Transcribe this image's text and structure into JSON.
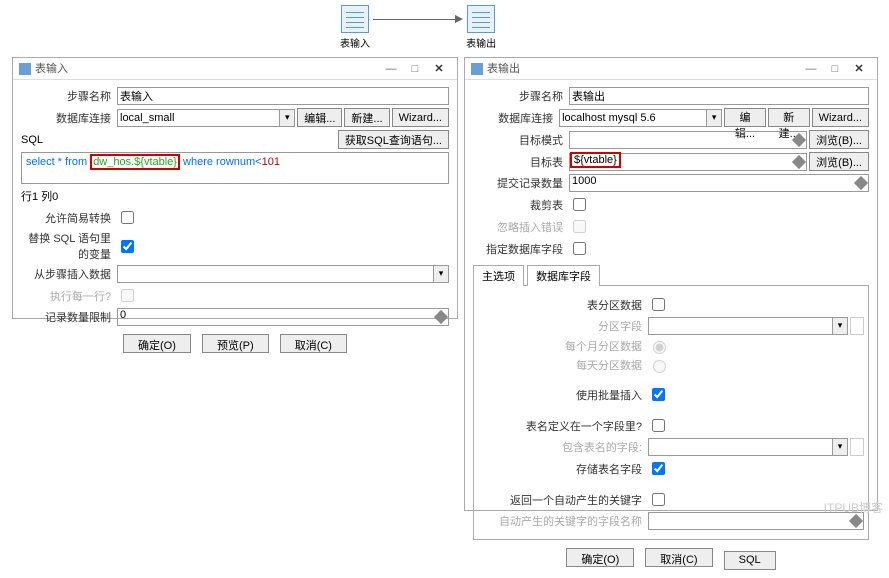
{
  "flow": {
    "node_in": "表输入",
    "node_out": "表输出"
  },
  "dlg_in": {
    "title": "表输入",
    "labels": {
      "step_name": "步骤名称",
      "db_conn": "数据库连接",
      "sql": "SQL",
      "allow_simple": "允许简易转换",
      "replace_vars": "替换 SQL 语句里的变量",
      "from_step": "从步骤插入数据",
      "per_row": "执行每一行?",
      "row_limit": "记录数量限制"
    },
    "values": {
      "step_name": "表输入",
      "db_conn": "local_small",
      "row_limit": "0"
    },
    "sql": {
      "p1": "select * from ",
      "hl": "dw_hos.${vtable}",
      "p2": " where rownum<",
      "p3": "101"
    },
    "buttons": {
      "edit": "编辑...",
      "new": "新建...",
      "wizard": "Wizard...",
      "get_sql": "获取SQL查询语句..."
    },
    "status": "行1 列0",
    "footer": {
      "ok": "确定(O)",
      "preview": "预览(P)",
      "cancel": "取消(C)"
    }
  },
  "dlg_out": {
    "title": "表输出",
    "labels": {
      "step_name": "步骤名称",
      "db_conn": "数据库连接",
      "target_schema": "目标模式",
      "target_table": "目标表",
      "commit_size": "提交记录数量",
      "truncate": "裁剪表",
      "ignore_errors": "忽略插入错误",
      "specify_fields": "指定数据库字段",
      "partition": "表分区数据",
      "partition_field": "分区字段",
      "per_month": "每个月分区数据",
      "per_day": "每天分区数据",
      "batch": "使用批量插入",
      "name_in_field": "表名定义在一个字段里?",
      "contain_name_field": "包含表名的字段:",
      "store_name_field": "存储表名字段",
      "return_key": "返回一个自动产生的关键字",
      "auto_key_field": "自动产生的关键字的字段名称"
    },
    "values": {
      "step_name": "表输出",
      "db_conn": "localhost mysql 5.6",
      "target_table": "${vtable}",
      "commit_size": "1000"
    },
    "tabs": {
      "main": "主选项",
      "fields": "数据库字段"
    },
    "buttons": {
      "edit": "编辑...",
      "new": "新建...",
      "wizard": "Wizard...",
      "browse": "浏览(B)..."
    },
    "footer": {
      "ok": "确定(O)",
      "cancel": "取消(C)",
      "sql": "SQL"
    }
  },
  "watermark": "ITPUB博客"
}
